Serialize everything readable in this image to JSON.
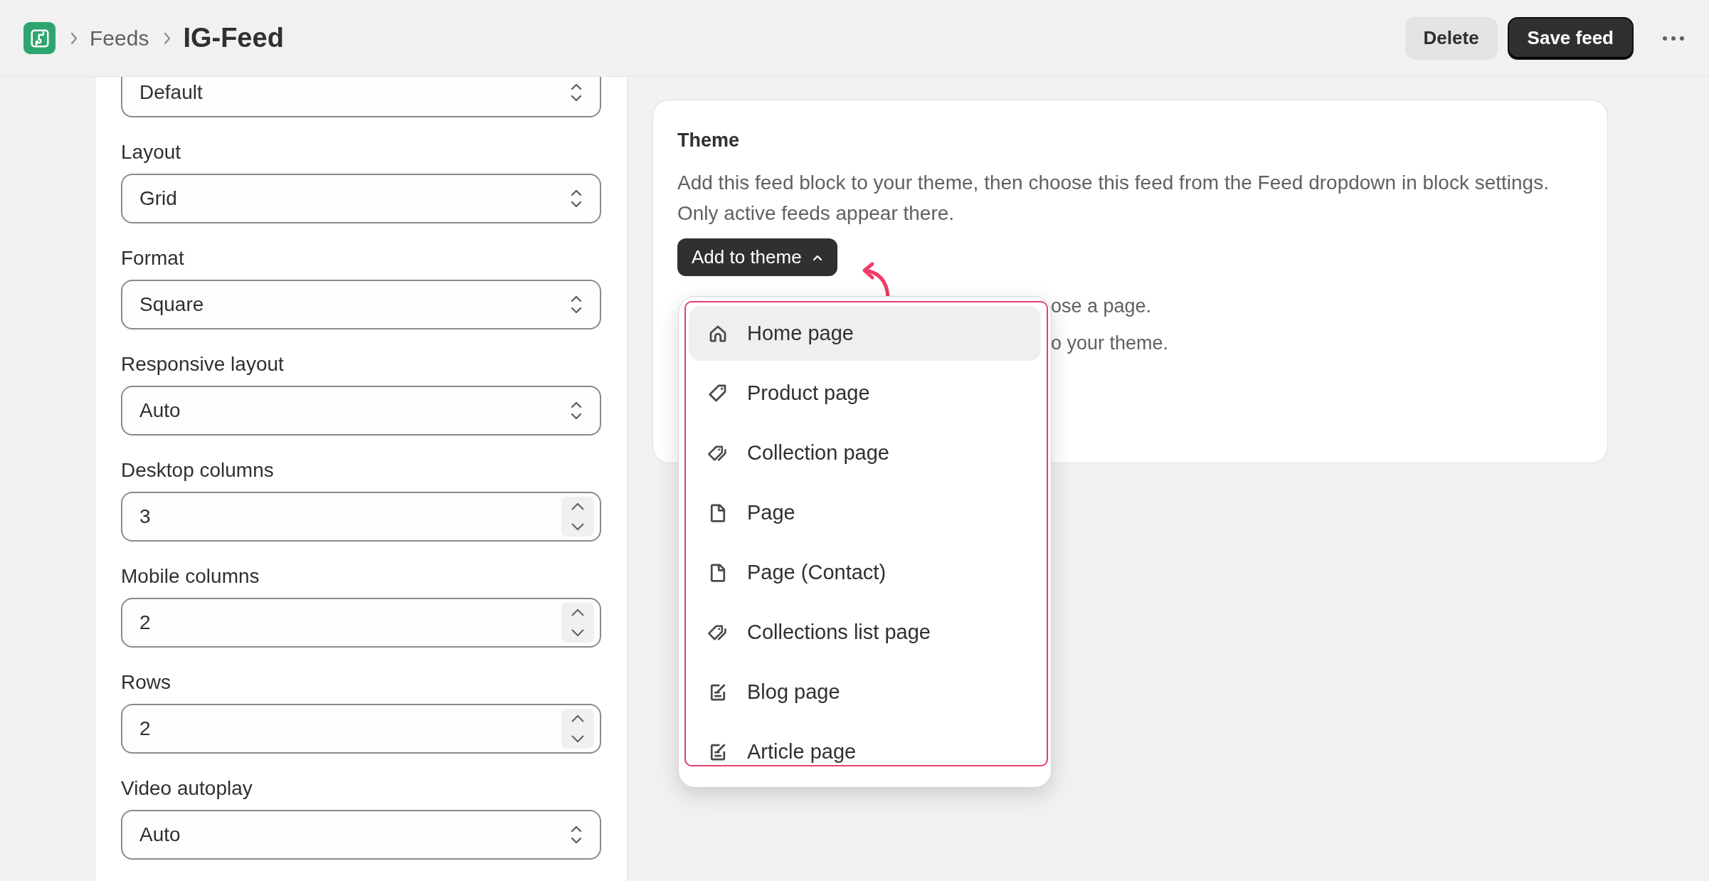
{
  "breadcrumb": {
    "items": [
      {
        "label": "Feeds"
      }
    ],
    "current": "IG-Feed"
  },
  "actions": [
    {
      "label": "Delete",
      "kind": "secondary"
    },
    {
      "label": "Save feed",
      "kind": "primary"
    }
  ],
  "settings": [
    {
      "kind": "select",
      "value": "Default"
    },
    {
      "kind": "select",
      "label": "Layout",
      "value": "Grid"
    },
    {
      "kind": "select",
      "label": "Format",
      "value": "Square"
    },
    {
      "kind": "select",
      "label": "Responsive layout",
      "value": "Auto"
    },
    {
      "kind": "number",
      "label": "Desktop columns",
      "value": "3"
    },
    {
      "kind": "number",
      "label": "Mobile columns",
      "value": "2"
    },
    {
      "kind": "number",
      "label": "Rows",
      "value": "2"
    },
    {
      "kind": "select",
      "label": "Video autoplay",
      "value": "Auto"
    }
  ],
  "theme_card": {
    "title": "Theme",
    "description": "Add this feed block to your theme, then choose this feed from the Feed dropdown in block settings. Only active feeds appear there.",
    "button": "Add to theme",
    "expanded": true,
    "notes": [
      "ose a page.",
      "o your theme."
    ]
  },
  "menu": {
    "items": [
      {
        "label": "Home page",
        "kind": "home",
        "selected": true
      },
      {
        "label": "Product page",
        "kind": "tag",
        "selected": false
      },
      {
        "label": "Collection page",
        "kind": "tags",
        "selected": false
      },
      {
        "label": "Page",
        "kind": "file",
        "selected": false
      },
      {
        "label": "Page (Contact)",
        "kind": "file",
        "selected": false
      },
      {
        "label": "Collections list page",
        "kind": "tags",
        "selected": false
      },
      {
        "label": "Blog page",
        "kind": "edit",
        "selected": false
      },
      {
        "label": "Article page",
        "kind": "edit",
        "selected": false
      }
    ]
  }
}
